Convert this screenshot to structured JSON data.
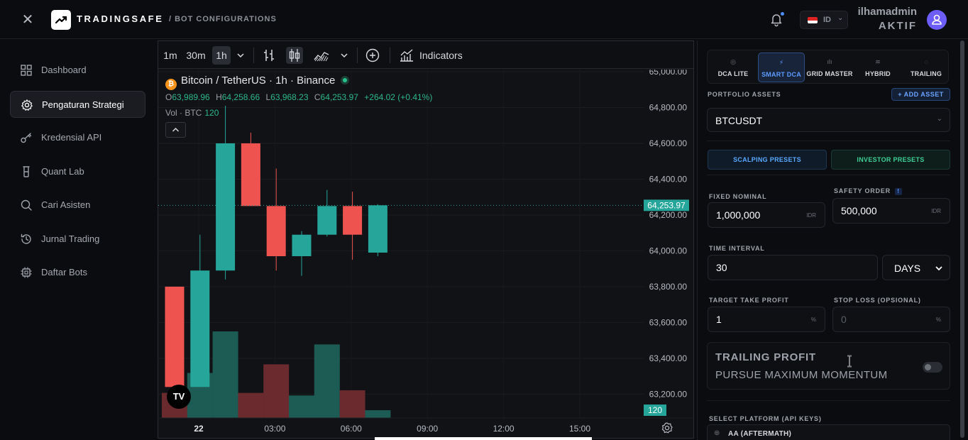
{
  "header": {
    "brand": "TRADINGSAFE",
    "breadcrumb": "/  BOT CONFIGURATIONS",
    "lang_code": "ID",
    "user_name": "ilhamadmin",
    "user_status": "AKTIF"
  },
  "sidebar": {
    "items": [
      {
        "label": "Dashboard",
        "icon": "grid-icon",
        "active": false
      },
      {
        "label": "Pengaturan Strategi",
        "icon": "gear-icon",
        "active": true
      },
      {
        "label": "Kredensial API",
        "icon": "key-icon",
        "active": false
      },
      {
        "label": "Quant Lab",
        "icon": "flask-icon",
        "active": false
      },
      {
        "label": "Cari Asisten",
        "icon": "search-icon",
        "active": false
      },
      {
        "label": "Jurnal Trading",
        "icon": "history-icon",
        "active": false
      },
      {
        "label": "Daftar Bots",
        "icon": "chip-icon",
        "active": false
      }
    ]
  },
  "chart": {
    "timeframes": [
      "1m",
      "30m",
      "1h"
    ],
    "active_timeframe": "1h",
    "indicators_label": "Indicators",
    "symbol_title": "Bitcoin / TetherUS · 1h · Binance",
    "ohlc": {
      "O": "63,989.96",
      "H": "64,258.66",
      "L": "63,968.23",
      "C": "64,253.97",
      "change": "+264.02 (+0.41%)"
    },
    "volume_label": "Vol · BTC",
    "volume_value": "120",
    "logo_text": "TV"
  },
  "chart_data": {
    "type": "candlestick",
    "price_axis": [
      "65,000.00",
      "64,800.00",
      "64,600.00",
      "64,400.00",
      "64,200.00",
      "64,000.00",
      "63,800.00",
      "63,600.00",
      "63,400.00",
      "63,200.00"
    ],
    "ylim": [
      63150,
      65000
    ],
    "time_axis": [
      "22",
      "03:00",
      "06:00",
      "09:00",
      "12:00",
      "15:00"
    ],
    "last_price_label": "64,253.97",
    "last_price": 64253.97,
    "volume_axis_label": "120",
    "colors": {
      "up": "#26a69a",
      "down": "#ef5350",
      "vol_up": "#1d5b55",
      "vol_down": "#6b2a2e"
    },
    "candles": [
      {
        "o": 63800,
        "h": 63800,
        "l": 63240,
        "c": 63240,
        "vol": 0.29
      },
      {
        "o": 63240,
        "h": 64090,
        "l": 63240,
        "c": 63890,
        "vol": 0.52
      },
      {
        "o": 63890,
        "h": 64810,
        "l": 63840,
        "c": 64600,
        "vol": 1.0
      },
      {
        "o": 64600,
        "h": 64660,
        "l": 64250,
        "c": 64250,
        "vol": 0.29
      },
      {
        "o": 64250,
        "h": 64460,
        "l": 63890,
        "c": 63970,
        "vol": 0.62
      },
      {
        "o": 63970,
        "h": 64110,
        "l": 63860,
        "c": 64090,
        "vol": 0.26
      },
      {
        "o": 64090,
        "h": 64340,
        "l": 64080,
        "c": 64250,
        "vol": 0.85
      },
      {
        "o": 64250,
        "h": 64330,
        "l": 63950,
        "c": 64090,
        "vol": 0.32
      },
      {
        "o": 63990,
        "h": 64260,
        "l": 63970,
        "c": 64254,
        "vol": 0.09
      }
    ]
  },
  "config": {
    "tabs": [
      {
        "label": "DCA LITE",
        "icon": "layers-icon",
        "active": false
      },
      {
        "label": "SMART DCA",
        "icon": "bolt-icon",
        "active": true
      },
      {
        "label": "GRID MASTER",
        "icon": "bars-icon",
        "active": false
      },
      {
        "label": "HYBRID",
        "icon": "stack-icon",
        "active": false
      },
      {
        "label": "TRAILING",
        "icon": "shield-icon",
        "active": false
      }
    ],
    "portfolio_label": "PORTFOLIO ASSETS",
    "add_asset_label": "+ ADD ASSET",
    "asset_value": "BTCUSDT",
    "scalping_presets": "SCALPING PRESETS",
    "investor_presets": "INVESTOR PRESETS",
    "fixed_nominal_label": "FIXED NOMINAL",
    "fixed_nominal_value": "1,000,000",
    "fixed_nominal_unit": "IDR",
    "safety_order_label": "SAFETY ORDER",
    "safety_order_info": "!",
    "safety_order_value": "500,000",
    "safety_order_unit": "IDR",
    "time_interval_label": "TIME INTERVAL",
    "time_interval_value": "30",
    "time_unit_value": "DAYS",
    "take_profit_label": "TARGET TAKE PROFIT",
    "take_profit_value": "1",
    "take_profit_unit": "%",
    "stop_loss_label": "STOP LOSS (OPSIONAL)",
    "stop_loss_placeholder": "0",
    "stop_loss_unit": "%",
    "trailing_title": "TRAILING PROFIT",
    "trailing_subtitle": "PURSUE MAXIMUM MOMENTUM",
    "trailing_enabled": false,
    "platform_label": "SELECT PLATFORM (API KEYS)",
    "platform_option": "AA (AFTERMATH)"
  }
}
